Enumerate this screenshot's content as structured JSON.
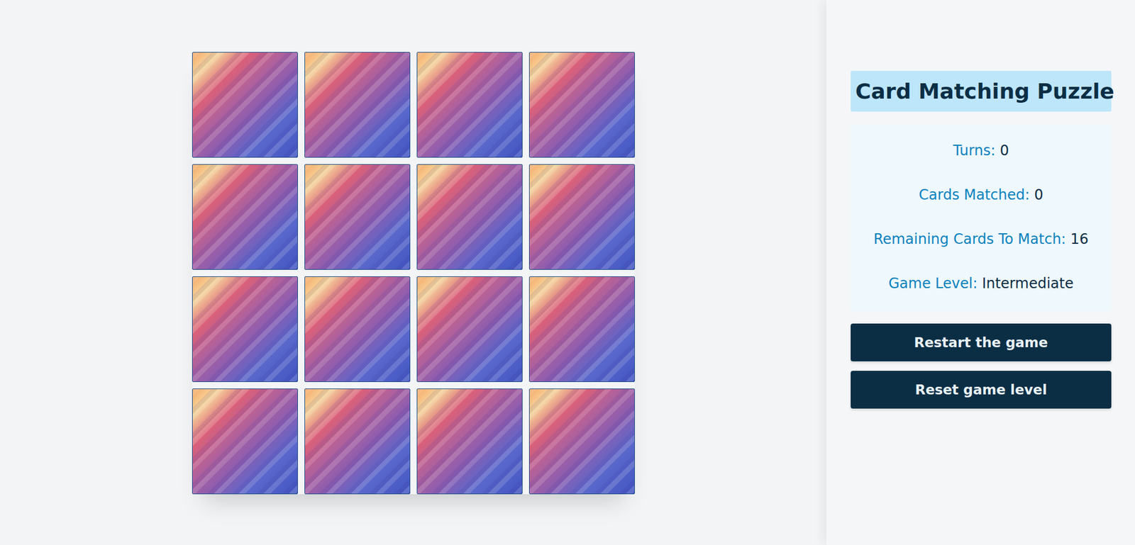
{
  "game": {
    "title": "Card Matching Puzzle",
    "stats": [
      {
        "label": "Turns:",
        "value": "0"
      },
      {
        "label": "Cards Matched:",
        "value": "0"
      },
      {
        "label": "Remaining Cards To Match:",
        "value": "16"
      },
      {
        "label": "Game Level:",
        "value": "Intermediate"
      }
    ],
    "buttons": [
      "Restart the game",
      "Reset game level"
    ],
    "cards": [
      {
        "flipped": false
      },
      {
        "flipped": false
      },
      {
        "flipped": false
      },
      {
        "flipped": false
      },
      {
        "flipped": false
      },
      {
        "flipped": false
      },
      {
        "flipped": false
      },
      {
        "flipped": false
      },
      {
        "flipped": false
      },
      {
        "flipped": false
      },
      {
        "flipped": false
      },
      {
        "flipped": false
      },
      {
        "flipped": false
      },
      {
        "flipped": false
      },
      {
        "flipped": false
      },
      {
        "flipped": false
      }
    ]
  }
}
